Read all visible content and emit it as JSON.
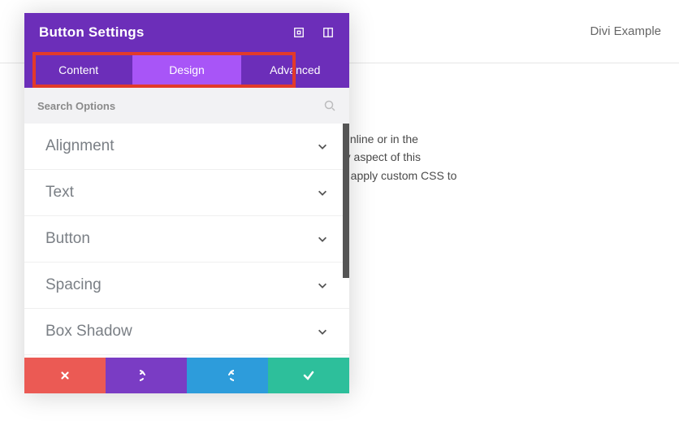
{
  "brand": "Divi Example",
  "panel": {
    "title": "Button Settings",
    "tabs": [
      "Content",
      "Design",
      "Advanced"
    ],
    "active_tab_index": 1,
    "search_placeholder": "Search Options",
    "sections": [
      "Alignment",
      "Text",
      "Button",
      "Spacing",
      "Box Shadow"
    ]
  },
  "bg_lines": [
    "t inline or in the",
    "ry aspect of this",
    "o apply custom CSS to"
  ],
  "colors": {
    "header": "#6c2eb9",
    "tab_active": "#a855f7",
    "highlight_box": "#e23a2a",
    "cancel": "#eb5a54",
    "undo": "#7a3cc4",
    "redo": "#2d9cdb",
    "save": "#2dbf9b"
  }
}
